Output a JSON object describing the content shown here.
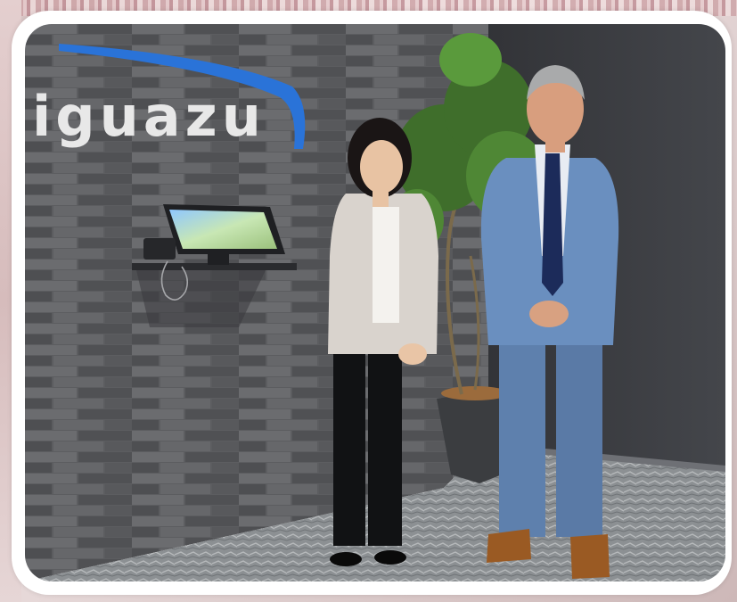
{
  "photo": {
    "logo_text": "iguazu",
    "accent_color": "#2a73d8",
    "wall_color": "#5a5a5c",
    "dark_wall_color": "#3b3c40",
    "suit_color": "#6a8fbf",
    "tie_color": "#1c2b5a",
    "icons": [
      "tablet-kiosk-icon",
      "telephone-icon",
      "plant-pot-icon"
    ]
  }
}
